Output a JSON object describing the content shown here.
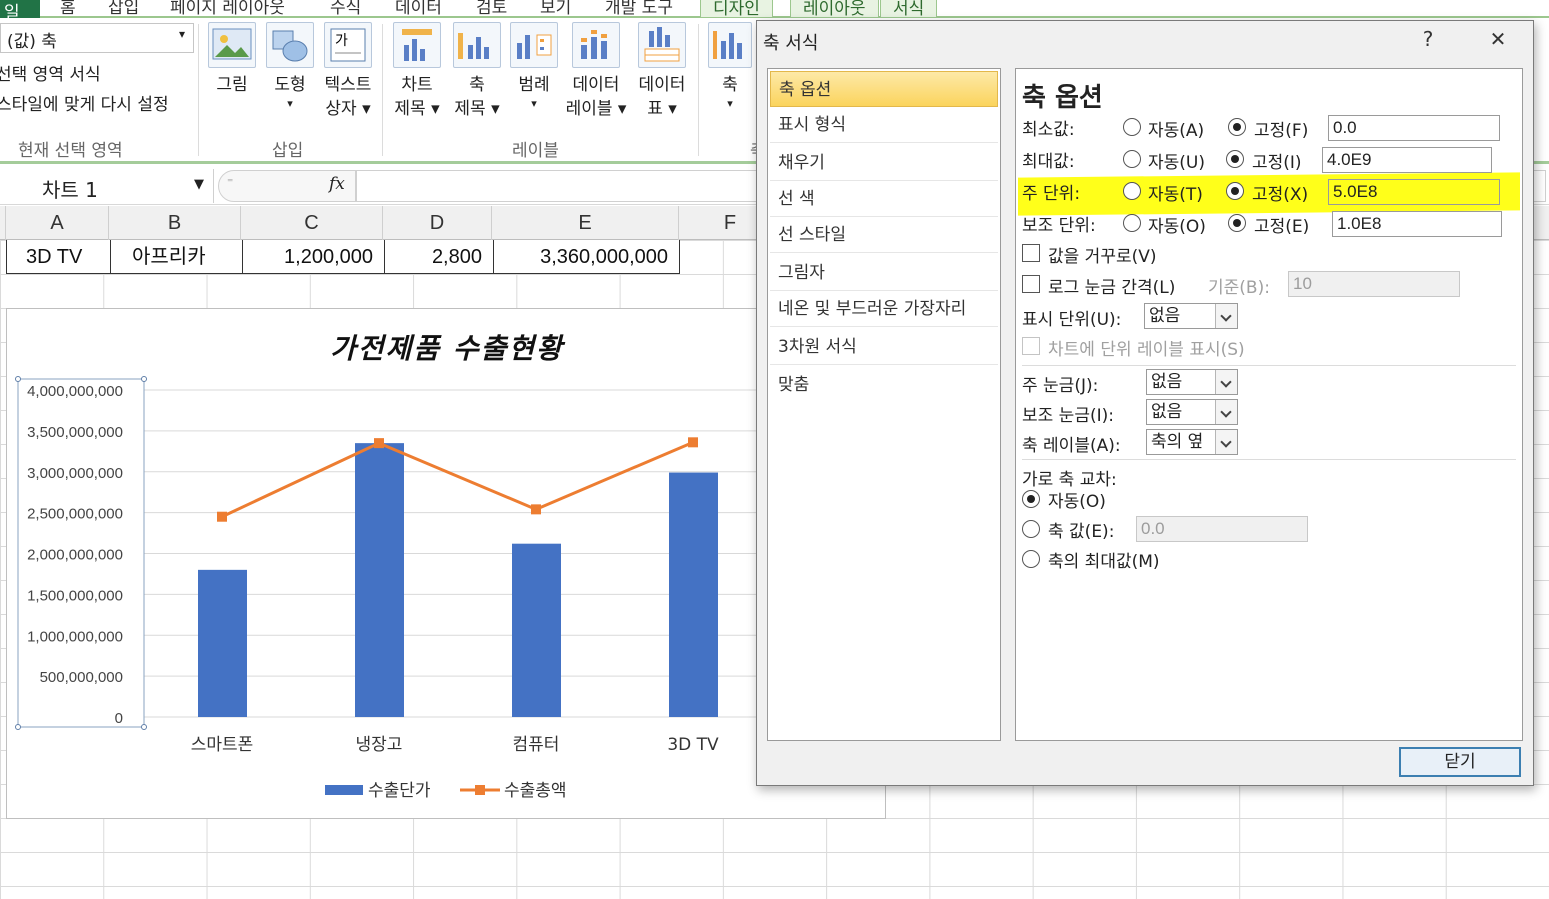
{
  "ribbon": {
    "tabs": [
      "일",
      "홈",
      "삽입",
      "페이지 레이아웃",
      "수식",
      "데이터",
      "검토",
      "보기",
      "개발 도구",
      "디자인",
      "레이아웃",
      "서식"
    ],
    "axis_selector": "(값) 축",
    "format_selection": "선택 영역 서식",
    "reset_style": "스타일에 맞게 다시 설정",
    "group_current_selection": "현재 선택 영역",
    "insert_picture": "그림",
    "insert_shape": "도형",
    "insert_textbox_line1": "텍스트",
    "insert_textbox_line2": "상자",
    "group_insert": "삽입",
    "chart_title_line1": "차트",
    "chart_title_line2": "제목",
    "axis_title_line1": "축",
    "axis_title_line2": "제목",
    "legend": "범례",
    "data_labels_line1": "데이터",
    "data_labels_line2": "레이블",
    "data_table_line1": "데이터",
    "data_table_line2": "표",
    "group_labels": "레이블",
    "axes": "축",
    "group_axes_partial": "축"
  },
  "formula_bar": {
    "name_box": "차트 1",
    "fx": "fx"
  },
  "sheet": {
    "columns": [
      "A",
      "B",
      "C",
      "D",
      "E",
      "F"
    ],
    "row": [
      "3D TV",
      "아프리카",
      "1,200,000",
      "2,800",
      "3,360,000,000"
    ]
  },
  "chart_data": {
    "type": "bar",
    "title": "가전제품 수출현황",
    "categories": [
      "스마트폰",
      "냉장고",
      "컴퓨터",
      "3D TV"
    ],
    "series": [
      {
        "name": "수출단가",
        "type": "bar",
        "values": [
          1800000000,
          3350000000,
          2120000000,
          2990000000
        ]
      },
      {
        "name": "수출총액",
        "type": "line",
        "values": [
          2450000000,
          3350000000,
          2540000000,
          3360000000
        ]
      }
    ],
    "y_ticks": [
      "4,000,000,000",
      "3,500,000,000",
      "3,000,000,000",
      "2,500,000,000",
      "2,000,000,000",
      "1,500,000,000",
      "1,000,000,000",
      "500,000,000",
      "0"
    ],
    "ylim": [
      0,
      4000000000
    ],
    "grid": true,
    "legend_position": "bottom",
    "colors": {
      "bar": "#4472c4",
      "line": "#ed7d31"
    }
  },
  "dialog": {
    "title": "축 서식",
    "help": "?",
    "close_x": "✕",
    "nav": [
      "축 옵션",
      "표시 형식",
      "채우기",
      "선 색",
      "선 스타일",
      "그림자",
      "네온 및 부드러운 가장자리",
      "3차원 서식",
      "맞춤"
    ],
    "heading": "축 옵션",
    "min_label": "최소값:",
    "max_label": "최대값:",
    "major_label": "주 단위:",
    "minor_label": "보조 단위:",
    "auto_a": "자동(A)",
    "fixed_f": "고정(F)",
    "min_value": "0.0",
    "auto_u": "자동(U)",
    "fixed_i": "고정(I)",
    "max_value": "4.0E9",
    "auto_t": "자동(T)",
    "fixed_x": "고정(X)",
    "major_value": "5.0E8",
    "auto_o": "자동(O)",
    "fixed_e": "고정(E)",
    "minor_value": "1.0E8",
    "reverse": "값을 거꾸로(V)",
    "log_scale": "로그 눈금 간격(L)",
    "base_label": "기준(B):",
    "base_value": "10",
    "display_units_label": "표시 단위(U):",
    "display_units_value": "없음",
    "show_units_label": "차트에 단위 레이블 표시(S)",
    "major_tick_label": "주 눈금(J):",
    "major_tick_value": "없음",
    "minor_tick_label": "보조 눈금(I):",
    "minor_tick_value": "없음",
    "axis_labels_label": "축 레이블(A):",
    "axis_labels_value": "축의 옆",
    "crosses_label": "가로 축 교차:",
    "cross_auto": "자동(O)",
    "cross_value_label": "축 값(E):",
    "cross_value": "0.0",
    "cross_max": "축의 최대값(M)",
    "close_button": "닫기",
    "highlight_color": "#ffff1a"
  }
}
